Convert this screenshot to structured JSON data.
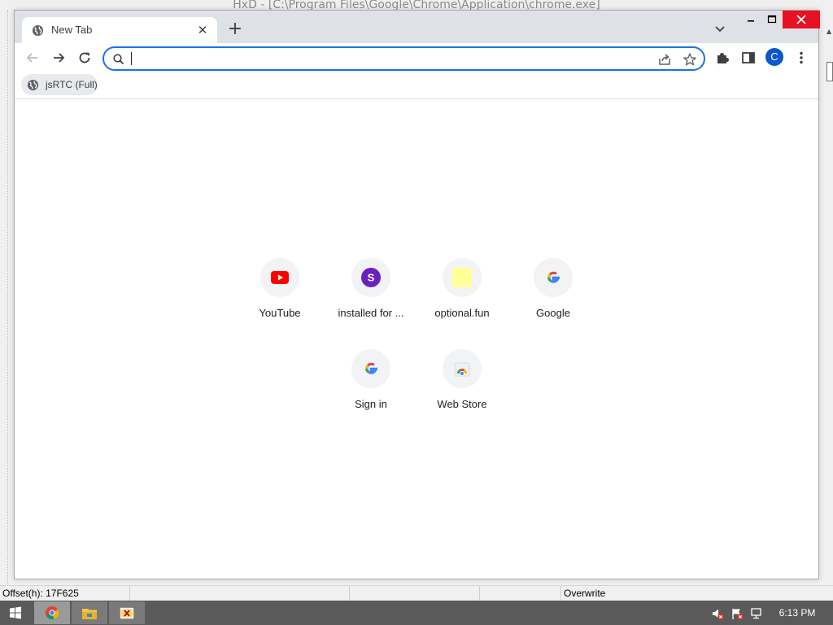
{
  "host_app": {
    "title": "HxD - [C:\\Program Files\\Google\\Chrome\\Application\\chrome.exe]",
    "status": {
      "offset": "Offset(h): 17F625",
      "mode": "Overwrite"
    }
  },
  "browser": {
    "tab": {
      "title": "New Tab"
    },
    "omnibox": {
      "value": "",
      "placeholder": ""
    },
    "profile_initial": "C",
    "bookmarks": [
      {
        "label": "jsRTC (Full)",
        "icon": "globe-icon"
      }
    ],
    "shortcuts": [
      {
        "label": "YouTube",
        "icon": "youtube-icon"
      },
      {
        "label": "installed for ...",
        "icon": "s-letter-icon",
        "letter": "S"
      },
      {
        "label": "optional.fun",
        "icon": "yellow-square-icon"
      },
      {
        "label": "Google",
        "icon": "google-icon"
      },
      {
        "label": "Sign in",
        "icon": "google-icon"
      },
      {
        "label": "Web Store",
        "icon": "web-store-icon"
      }
    ]
  },
  "taskbar": {
    "clock": "6:13 PM",
    "apps": [
      "chrome-icon",
      "file-explorer-icon",
      "hxd-icon"
    ]
  },
  "colors": {
    "accent": "#1a73e8",
    "close_red": "#e81123",
    "youtube_red": "#ff0000",
    "s_purple": "#6a1fc2",
    "yellow_tile": "#ffff99"
  }
}
